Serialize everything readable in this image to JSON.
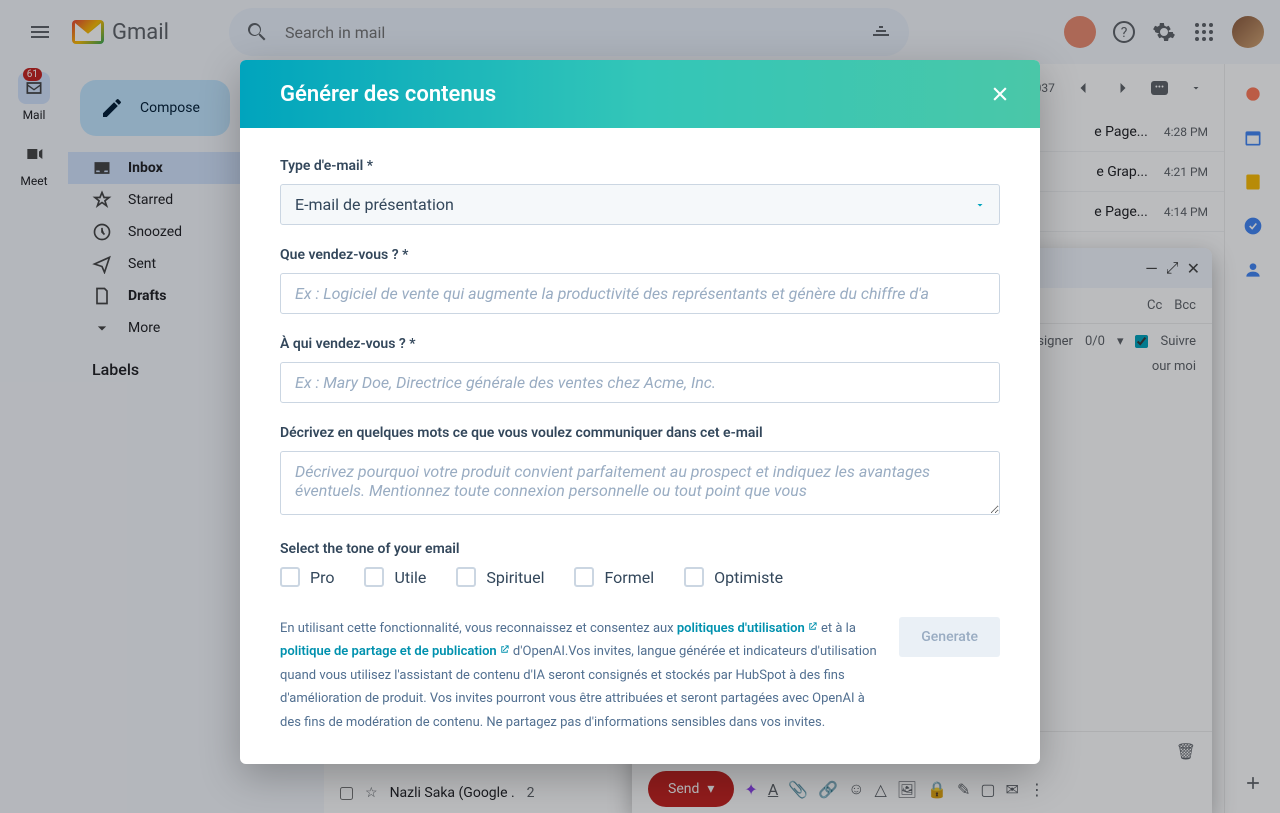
{
  "header": {
    "logo_text": "Gmail",
    "search_placeholder": "Search in mail"
  },
  "rail": {
    "mail_label": "Mail",
    "mail_badge": "61",
    "meet_label": "Meet"
  },
  "sidebar": {
    "compose": "Compose",
    "items": [
      {
        "label": "Inbox"
      },
      {
        "label": "Starred"
      },
      {
        "label": "Snoozed"
      },
      {
        "label": "Sent"
      },
      {
        "label": "Drafts"
      },
      {
        "label": "More"
      }
    ],
    "labels_header": "Labels"
  },
  "toolbar": {
    "count_suffix": "037",
    "density": "▦"
  },
  "mails": [
    {
      "subject": "e Page...",
      "time": "4:28 PM"
    },
    {
      "subject": "e Grap...",
      "time": "4:21 PM"
    },
    {
      "subject": "e Page...",
      "time": "4:14 PM"
    }
  ],
  "compose_window": {
    "cc": "Cc",
    "bcc": "Bcc",
    "assign": "signer",
    "assign_count": "0/0",
    "follow": "Suivre",
    "for_me": "our moi",
    "send": "Send",
    "sender_row": "Nazli Saka (Google .",
    "sender_count": "2"
  },
  "modal": {
    "title": "Générer des contenus",
    "fields": {
      "type_label": "Type d'e-mail *",
      "type_value": "E-mail de présentation",
      "sell_label": "Que vendez-vous ? *",
      "sell_placeholder": "Ex : Logiciel de vente qui augmente la productivité des représentants et génère du chiffre d'a",
      "to_label": "À qui vendez-vous ? *",
      "to_placeholder": "Ex : Mary Doe, Directrice générale des ventes chez Acme, Inc.",
      "desc_label": "Décrivez en quelques mots ce que vous voulez communiquer dans cet e-mail",
      "desc_placeholder": "Décrivez pourquoi votre produit convient parfaitement au prospect et indiquez les avantages éventuels. Mentionnez toute connexion personnelle ou tout point que vous",
      "tone_label": "Select the tone of your email"
    },
    "tones": [
      "Pro",
      "Utile",
      "Spirituel",
      "Formel",
      "Optimiste"
    ],
    "disclaimer": {
      "part1": "En utilisant cette fonctionnalité, vous reconnaissez et consentez aux ",
      "link1": "politiques d'utilisation",
      "part2": " et à la ",
      "link2": "politique de partage et de publication",
      "part3": " d'OpenAI.Vos invites, langue générée et indicateurs d'utilisation quand vous utilisez l'assistant de contenu d'IA seront consignés et stockés par HubSpot à des fins d'amélioration de produit. Vos invites pourront vous être attribuées et seront partagées avec OpenAI à des fins de modération de contenu. Ne partagez pas d'informations sensibles dans vos invites."
    },
    "generate": "Generate"
  }
}
